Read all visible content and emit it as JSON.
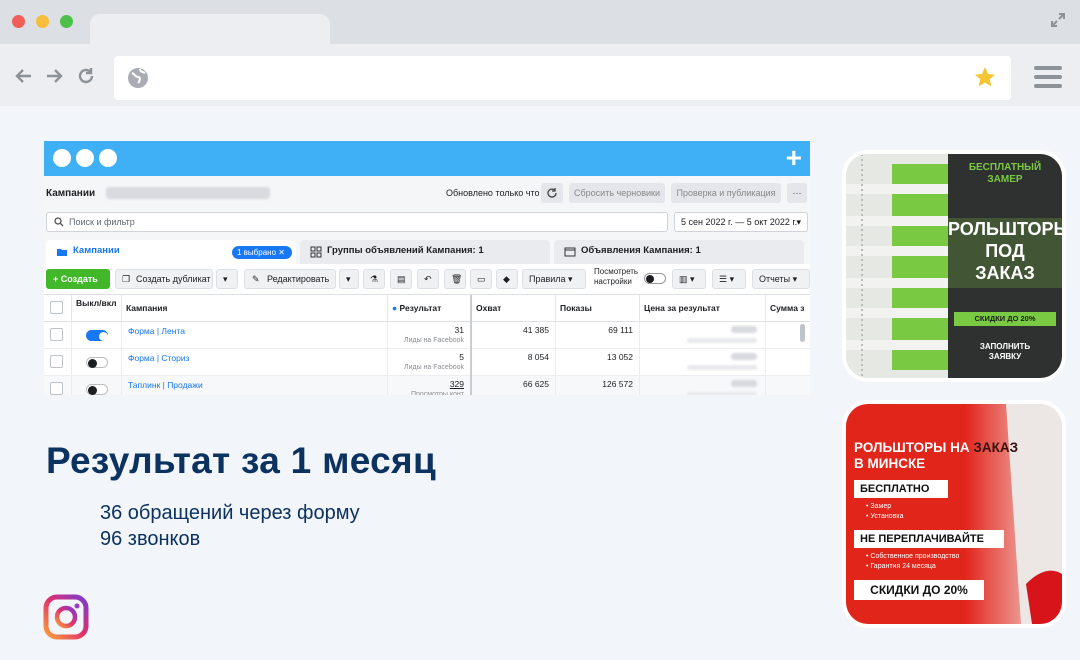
{
  "ads_manager": {
    "title": "Кампании",
    "updated": "Обновлено только что",
    "buttons": {
      "discard": "Сбросить черновики",
      "publish": "Проверка и публикация",
      "more": "···"
    },
    "search_placeholder": "Поиск и фильтр",
    "date_range": "5 сен 2022 г. — 5 окт 2022 г.",
    "tabs": [
      {
        "label": "Кампании",
        "chip": "1 выбрано ✕"
      },
      {
        "label": "Группы объявлений Кампания: 1"
      },
      {
        "label": "Объявления Кампания: 1"
      }
    ],
    "actions": {
      "create": "+ Создать",
      "duplicate": "Создать дубликат",
      "edit": "Редактировать",
      "rules": "Правила",
      "view_settings": "Посмотреть настройки",
      "reports": "Отчеты"
    },
    "columns": [
      "Выкл/вкл",
      "Кампания",
      "Результат",
      "Охват",
      "Показы",
      "Цена за результат",
      "Сумма з"
    ],
    "rows": [
      {
        "name": "Форма | Лента",
        "on": true,
        "result": "31",
        "result_sub": "Лиды на Facebook",
        "reach": "41 385",
        "impressions": "69 111"
      },
      {
        "name": "Форма | Сториз",
        "on": false,
        "result": "5",
        "result_sub": "Лиды на Facebook",
        "reach": "8 054",
        "impressions": "13 052"
      },
      {
        "name": "Таплинк | Продажи",
        "on": false,
        "result": "329",
        "result_sub": "Просмотры конт",
        "reach": "66 625",
        "impressions": "126 572"
      }
    ]
  },
  "headline": "Результат за 1 месяц",
  "stats": [
    "36 обращений через форму",
    "96 звонков"
  ],
  "ad1": {
    "top": "БЕСПЛАТНЫЙ\nЗАМЕР",
    "main": [
      "РОЛЬШТОРЫ",
      "ПОД",
      "ЗАКАЗ"
    ],
    "discount": "СКИДКИ ДО 20%",
    "cta": "ЗАПОЛНИТЬ\nЗАЯВКУ"
  },
  "ad2": {
    "title_white": "РОЛЬШТОРЫ НА ",
    "title_accent": "ЗАКАЗ",
    "title_line2": "В МИНСКЕ",
    "free": "БЕСПЛАТНО",
    "free_items": [
      "Замер",
      "Установка"
    ],
    "no_overpay": "НЕ ПЕРЕПЛАЧИВАЙТЕ",
    "no_overpay_items": [
      "Собственное производство",
      "Гарантия 24 месяца"
    ],
    "discount": "СКИДКИ ДО 20%"
  },
  "colors": {
    "brand_blue": "#3fb0f5",
    "fb_blue": "#1877f2",
    "create_green": "#42b72a",
    "headline": "#0c3260",
    "ad_green": "#7ac943",
    "ad_red": "#e1251b"
  }
}
